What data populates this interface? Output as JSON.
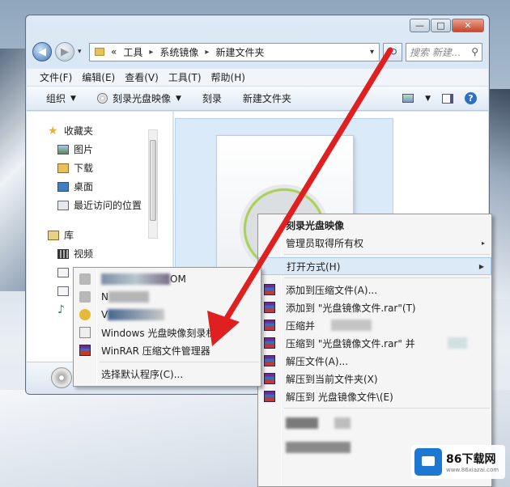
{
  "window": {
    "address": [
      "工具",
      "系统镜像",
      "新建文件夹"
    ],
    "address_prefix": "«",
    "search_placeholder": "搜索 新建...",
    "caption": {
      "minimize": "—",
      "maximize": "□",
      "close": "✕"
    }
  },
  "menubar": [
    "文件(F)",
    "编辑(E)",
    "查看(V)",
    "工具(T)",
    "帮助(H)"
  ],
  "toolbar": {
    "organize": "组织",
    "burn_image": "刻录光盘映像",
    "burn": "刻录",
    "new_folder": "新建文件夹"
  },
  "navpane": {
    "favorites": "收藏夹",
    "favorites_items": [
      "图片",
      "下载",
      "桌面",
      "最近访问的位置"
    ],
    "library": "库",
    "library_items": [
      "视频"
    ]
  },
  "context_menu": {
    "items": [
      "刻录光盘映像",
      "管理员取得所有权",
      "打开方式(H)",
      "添加到压缩文件(A)...",
      "添加到 \"光盘镜像文件.rar\"(T)",
      "压缩并",
      "压缩到 \"光盘镜像文件.rar\" 并",
      "解压文件(A)...",
      "解压到当前文件夹(X)",
      "解压到 光盘镜像文件\\(E)"
    ]
  },
  "open_with_menu": {
    "items": [
      "OM",
      "N",
      "V",
      "Windows 光盘映像刻录机",
      "WinRAR 压缩文件管理器",
      "选择默认程序(C)..."
    ]
  },
  "watermark": {
    "title": "86下载网",
    "url": "www.86xiazai.com"
  },
  "colors": {
    "arrow": "#e02020",
    "accent": "#1e78d2"
  }
}
